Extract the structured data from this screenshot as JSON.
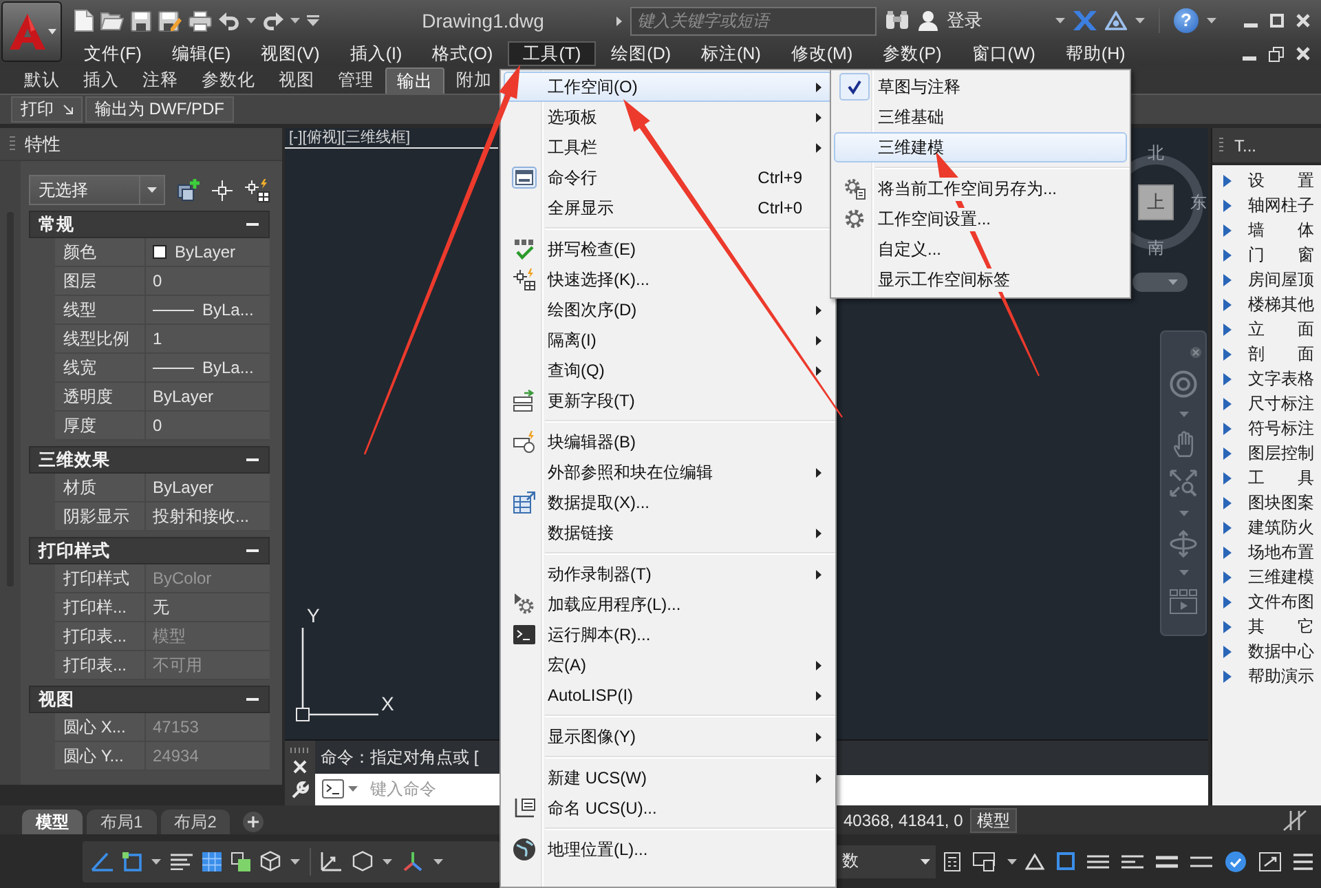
{
  "window": {
    "title": "Drawing1.dwg",
    "search": {
      "placeholder": "键入关键字或短语"
    },
    "sign_in": "登录",
    "help": "?"
  },
  "menu_bar": [
    {
      "label": "文件(F)",
      "selected": false
    },
    {
      "label": "编辑(E)",
      "selected": false
    },
    {
      "label": "视图(V)",
      "selected": false
    },
    {
      "label": "插入(I)",
      "selected": false
    },
    {
      "label": "格式(O)",
      "selected": false
    },
    {
      "label": "工具(T)",
      "selected": true
    },
    {
      "label": "绘图(D)",
      "selected": false
    },
    {
      "label": "标注(N)",
      "selected": false
    },
    {
      "label": "修改(M)",
      "selected": false
    },
    {
      "label": "参数(P)",
      "selected": false
    },
    {
      "label": "窗口(W)",
      "selected": false
    },
    {
      "label": "帮助(H)",
      "selected": false
    }
  ],
  "ribbon": {
    "tabs": [
      {
        "label": "默认",
        "selected": false
      },
      {
        "label": "插入",
        "selected": false
      },
      {
        "label": "注释",
        "selected": false
      },
      {
        "label": "参数化",
        "selected": false
      },
      {
        "label": "视图",
        "selected": false
      },
      {
        "label": "管理",
        "selected": false
      },
      {
        "label": "输出",
        "selected": true
      },
      {
        "label": "附加",
        "selected": false
      }
    ],
    "panels": [
      {
        "label": "打印",
        "launcher": true
      },
      {
        "label": "输出为 DWF/PDF",
        "launcher": false
      }
    ]
  },
  "properties": {
    "title": "特性",
    "selection": "无选择",
    "sections": [
      {
        "title": "常规",
        "expanded": true,
        "rows": [
          {
            "label": "颜色",
            "value": "ByLayer",
            "kind": "color",
            "disabled": false
          },
          {
            "label": "图层",
            "value": "0",
            "kind": "text",
            "disabled": false
          },
          {
            "label": "线型",
            "value": "ByLa...",
            "kind": "linetype",
            "disabled": false
          },
          {
            "label": "线型比例",
            "value": "1",
            "kind": "text",
            "disabled": false
          },
          {
            "label": "线宽",
            "value": "ByLa...",
            "kind": "linetype",
            "disabled": false
          },
          {
            "label": "透明度",
            "value": "ByLayer",
            "kind": "text",
            "disabled": false
          },
          {
            "label": "厚度",
            "value": "0",
            "kind": "text",
            "disabled": false
          }
        ]
      },
      {
        "title": "三维效果",
        "expanded": true,
        "rows": [
          {
            "label": "材质",
            "value": "ByLayer",
            "kind": "text",
            "disabled": false
          },
          {
            "label": "阴影显示",
            "value": "投射和接收...",
            "kind": "text",
            "disabled": false
          }
        ]
      },
      {
        "title": "打印样式",
        "expanded": true,
        "rows": [
          {
            "label": "打印样式",
            "value": "ByColor",
            "kind": "text",
            "disabled": true
          },
          {
            "label": "打印样...",
            "value": "无",
            "kind": "text",
            "disabled": false
          },
          {
            "label": "打印表...",
            "value": "模型",
            "kind": "text",
            "disabled": true
          },
          {
            "label": "打印表...",
            "value": "不可用",
            "kind": "text",
            "disabled": true
          }
        ]
      },
      {
        "title": "视图",
        "expanded": true,
        "rows": [
          {
            "label": "圆心 X...",
            "value": "47153",
            "kind": "text",
            "disabled": true
          },
          {
            "label": "圆心 Y...",
            "value": "24934",
            "kind": "text",
            "disabled": true
          }
        ]
      }
    ]
  },
  "drawing": {
    "viewport_label": "[-][俯视][三维线框]",
    "viewcube": {
      "north": "北",
      "top": "上",
      "east": "东",
      "south": "南"
    },
    "ucs": {
      "x_label": "X",
      "y_label": "Y"
    }
  },
  "tool_palette": {
    "title": "T...",
    "items": [
      {
        "label": "设　　置",
        "expanded": false
      },
      {
        "label": "轴网柱子",
        "expanded": false
      },
      {
        "label": "墙　　体",
        "expanded": false
      },
      {
        "label": "门　　窗",
        "expanded": false
      },
      {
        "label": "房间屋顶",
        "expanded": false
      },
      {
        "label": "楼梯其他",
        "expanded": false
      },
      {
        "label": "立　　面",
        "expanded": false
      },
      {
        "label": "剖　　面",
        "expanded": false
      },
      {
        "label": "文字表格",
        "expanded": false
      },
      {
        "label": "尺寸标注",
        "expanded": false
      },
      {
        "label": "符号标注",
        "expanded": false
      },
      {
        "label": "图层控制",
        "expanded": false
      },
      {
        "label": "工　　具",
        "expanded": false
      },
      {
        "label": "图块图案",
        "expanded": false
      },
      {
        "label": "建筑防火",
        "expanded": false
      },
      {
        "label": "场地布置",
        "expanded": false
      },
      {
        "label": "三维建模",
        "expanded": false
      },
      {
        "label": "文件布图",
        "expanded": false
      },
      {
        "label": "其　　它",
        "expanded": false
      },
      {
        "label": "数据中心",
        "expanded": false
      },
      {
        "label": "帮助演示",
        "expanded": false
      }
    ]
  },
  "command_line": {
    "history": "命令：指定对角点或 [",
    "placeholder": "键入命令"
  },
  "layout_tabs": [
    {
      "label": "模型",
      "selected": true
    },
    {
      "label": "布局1",
      "selected": false
    },
    {
      "label": "布局2",
      "selected": false
    }
  ],
  "status_bar": {
    "coordinates": "40368, 41841, 0",
    "space": "模型",
    "units": "数"
  },
  "tools_menu": {
    "groups": [
      {
        "items": [
          {
            "label": "工作空间(O)",
            "submenu": true,
            "selected": true
          },
          {
            "label": "选项板",
            "submenu": true,
            "selected": false
          },
          {
            "label": "工具栏",
            "submenu": true,
            "selected": false
          },
          {
            "label": "命令行",
            "shortcut": "Ctrl+9",
            "submenu": false,
            "selected": false
          },
          {
            "label": "全屏显示",
            "shortcut": "Ctrl+0",
            "submenu": false,
            "selected": false
          }
        ]
      },
      {
        "items": [
          {
            "label": "拼写检查(E)",
            "submenu": false,
            "selected": false
          },
          {
            "label": "快速选择(K)...",
            "submenu": false,
            "selected": false
          },
          {
            "label": "绘图次序(D)",
            "submenu": true,
            "selected": false
          },
          {
            "label": "隔离(I)",
            "submenu": true,
            "selected": false
          },
          {
            "label": "查询(Q)",
            "submenu": true,
            "selected": false
          },
          {
            "label": "更新字段(T)",
            "submenu": false,
            "selected": false
          }
        ]
      },
      {
        "items": [
          {
            "label": "块编辑器(B)",
            "submenu": false,
            "selected": false
          },
          {
            "label": "外部参照和块在位编辑",
            "submenu": true,
            "selected": false
          },
          {
            "label": "数据提取(X)...",
            "submenu": false,
            "selected": false
          },
          {
            "label": "数据链接",
            "submenu": true,
            "selected": false
          }
        ]
      },
      {
        "items": [
          {
            "label": "动作录制器(T)",
            "submenu": true,
            "selected": false
          },
          {
            "label": "加载应用程序(L)...",
            "submenu": false,
            "selected": false
          },
          {
            "label": "运行脚本(R)...",
            "submenu": false,
            "selected": false
          },
          {
            "label": "宏(A)",
            "submenu": true,
            "selected": false
          },
          {
            "label": "AutoLISP(I)",
            "submenu": true,
            "selected": false
          }
        ]
      },
      {
        "items": [
          {
            "label": "显示图像(Y)",
            "submenu": true,
            "selected": false
          }
        ]
      },
      {
        "items": [
          {
            "label": "新建 UCS(W)",
            "submenu": true,
            "selected": false
          },
          {
            "label": "命名 UCS(U)...",
            "submenu": false,
            "selected": false
          }
        ]
      },
      {
        "items": [
          {
            "label": "地理位置(L)...",
            "submenu": false,
            "selected": false
          }
        ]
      }
    ]
  },
  "workspace_menu": {
    "groups": [
      {
        "items": [
          {
            "label": "草图与注释",
            "checked": true,
            "selected": false
          },
          {
            "label": "三维基础",
            "checked": false,
            "selected": false
          },
          {
            "label": "三维建模",
            "checked": false,
            "selected": true
          }
        ]
      },
      {
        "items": [
          {
            "label": "将当前工作空间另存为...",
            "checked": false,
            "selected": false
          },
          {
            "label": "工作空间设置...",
            "checked": false,
            "selected": false
          },
          {
            "label": "自定义...",
            "checked": false,
            "selected": false
          },
          {
            "label": "显示工作空间标签",
            "checked": false,
            "selected": false
          }
        ]
      }
    ]
  },
  "annotations": [
    {
      "kind": "arrow"
    },
    {
      "kind": "arrow"
    },
    {
      "kind": "arrow"
    }
  ]
}
